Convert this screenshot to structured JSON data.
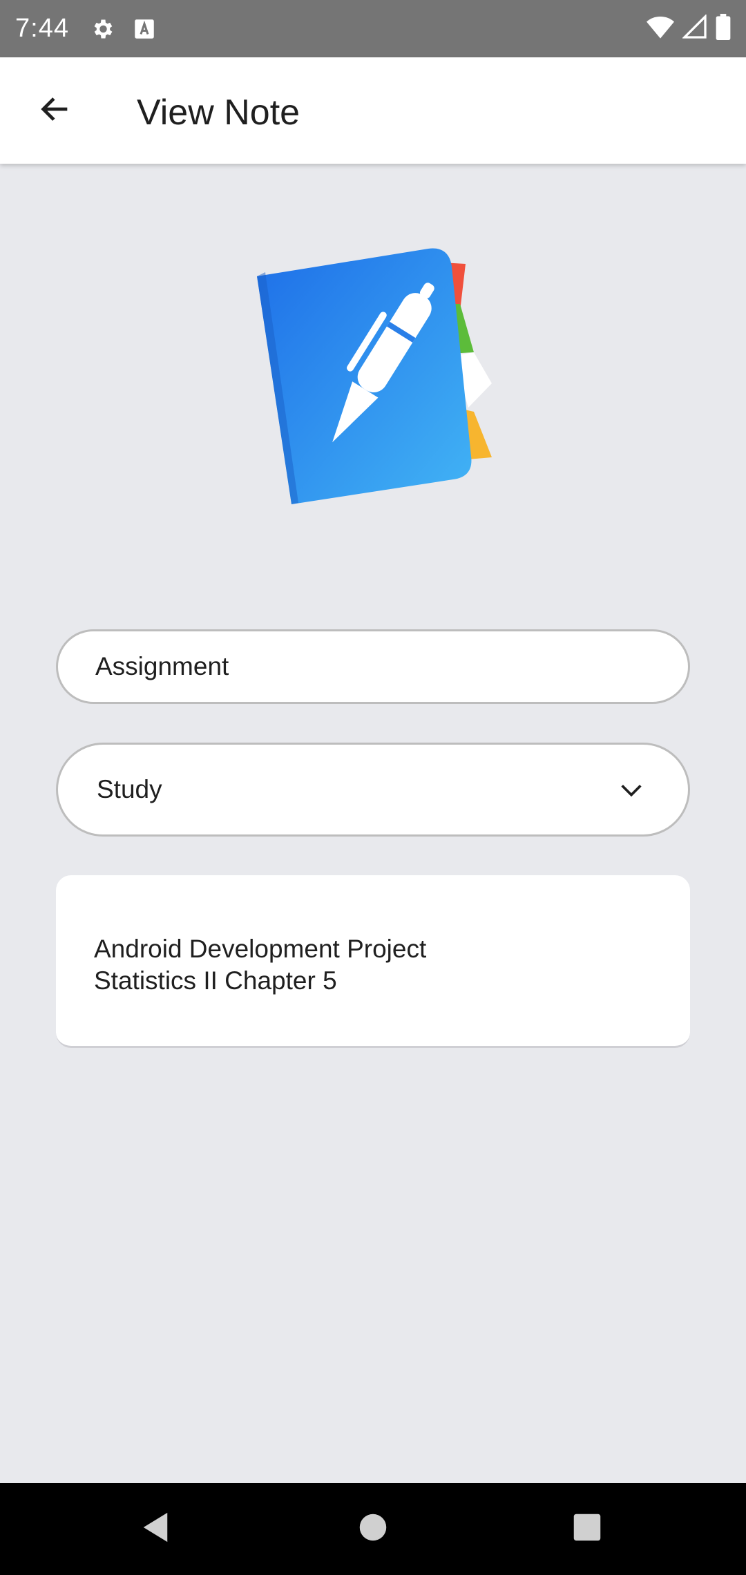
{
  "status_bar": {
    "time": "7:44",
    "icons_left": [
      "settings-icon",
      "keyboard-a-icon"
    ],
    "icons_right": [
      "wifi-icon",
      "cell-signal-icon",
      "battery-icon"
    ]
  },
  "app_bar": {
    "back_icon": "arrow-back-icon",
    "title": "View Note"
  },
  "form": {
    "title_value": "Assignment",
    "category_value": "Study",
    "note_lines": [
      "Android Development Project",
      "Statistics II Chapter 5"
    ]
  },
  "nav_bar": {
    "buttons": [
      "back-triangle-icon",
      "home-circle-icon",
      "recents-square-icon"
    ]
  },
  "colors": {
    "status_bar": "#757575",
    "app_bar": "#ffffff",
    "background": "#e8e9ed",
    "notebook_blue": "#2196f3"
  }
}
